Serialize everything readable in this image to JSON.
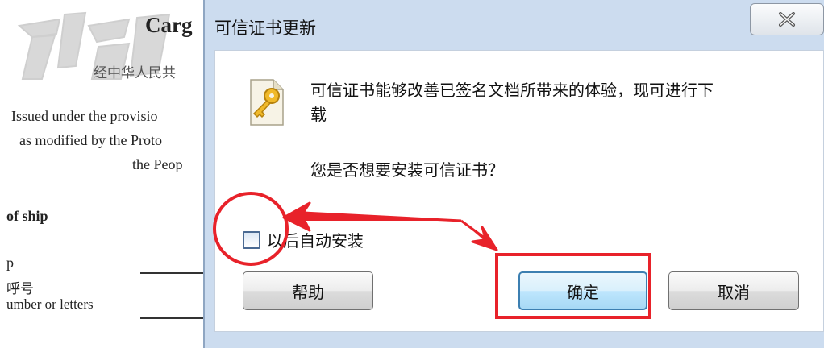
{
  "document": {
    "title": "Carg",
    "chinese_subtitle": "经中华人民共",
    "lines": [
      "Issued under the provisio",
      "as modified by the Proto",
      "the Peop",
      "of ship",
      "p",
      "呼号",
      "umber or letters"
    ]
  },
  "dialog": {
    "title": "可信证书更新",
    "message": "可信证书能够改善已签名文档所带来的体验，现可进行下载",
    "question": "您是否想要安装可信证书？",
    "checkbox_label": "以后自动安装",
    "checkbox_checked": false,
    "buttons": {
      "help": "帮助",
      "ok": "确定",
      "cancel": "取消"
    }
  },
  "colors": {
    "annotation_red": "#e8222a",
    "dialog_frame": "#ccdcef",
    "default_button_border": "#3c7fb1"
  }
}
